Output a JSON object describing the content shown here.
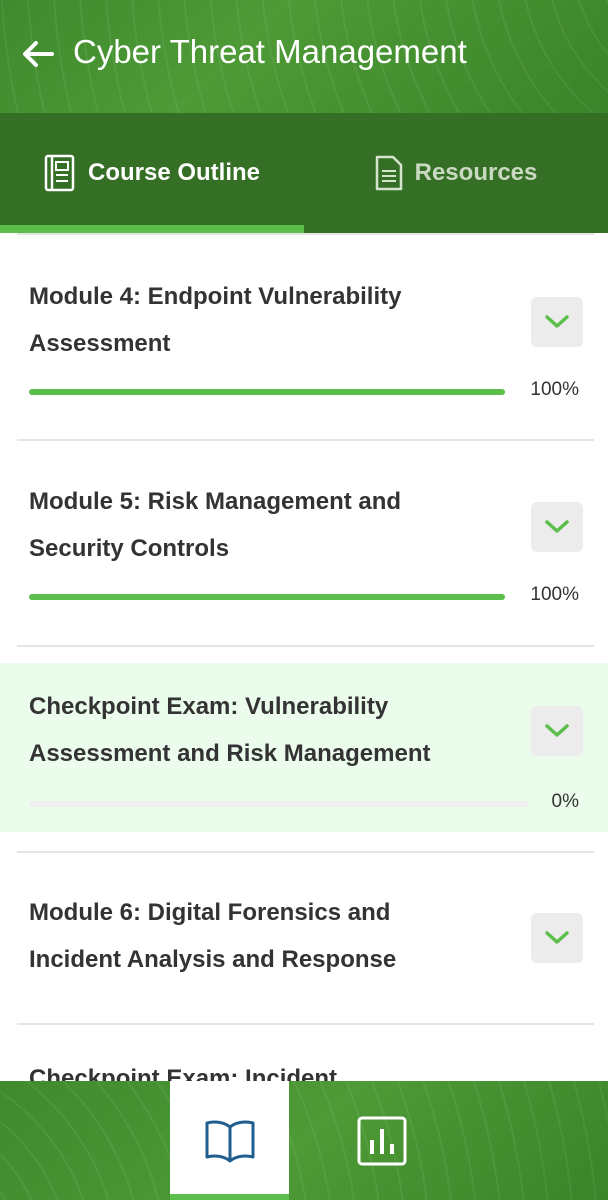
{
  "header": {
    "title": "Cyber Threat Management",
    "back_icon": "arrow-left-icon"
  },
  "tabs": [
    {
      "label": "Course Outline",
      "icon": "book-outline-icon",
      "active": true
    },
    {
      "label": "Resources",
      "icon": "document-icon",
      "active": false
    }
  ],
  "items": [
    {
      "line1": "Module 4: Endpoint Vulnerability",
      "line2": "Assessment",
      "progress": 100,
      "percent_label": "100%"
    },
    {
      "line1": "Module 5: Risk Management and",
      "line2": "Security Controls",
      "progress": 100,
      "percent_label": "100%"
    },
    {
      "line1": "Checkpoint Exam: Vulnerability",
      "line2": "Assessment and Risk Management",
      "progress": 0,
      "percent_label": "0%",
      "highlighted": true
    },
    {
      "line1": "Module 6: Digital Forensics and",
      "line2": "Incident Analysis and Response"
    },
    {
      "line1": "Checkpoint Exam: Incident"
    }
  ],
  "bottom_nav": [
    {
      "icon": "open-book-icon",
      "active": true
    },
    {
      "icon": "bar-chart-icon",
      "active": false
    }
  ],
  "colors": {
    "accent": "#5cbe4b",
    "header": "#4d9a36",
    "tab_bar": "#356e25",
    "highlight_row": "#ebfbec"
  }
}
